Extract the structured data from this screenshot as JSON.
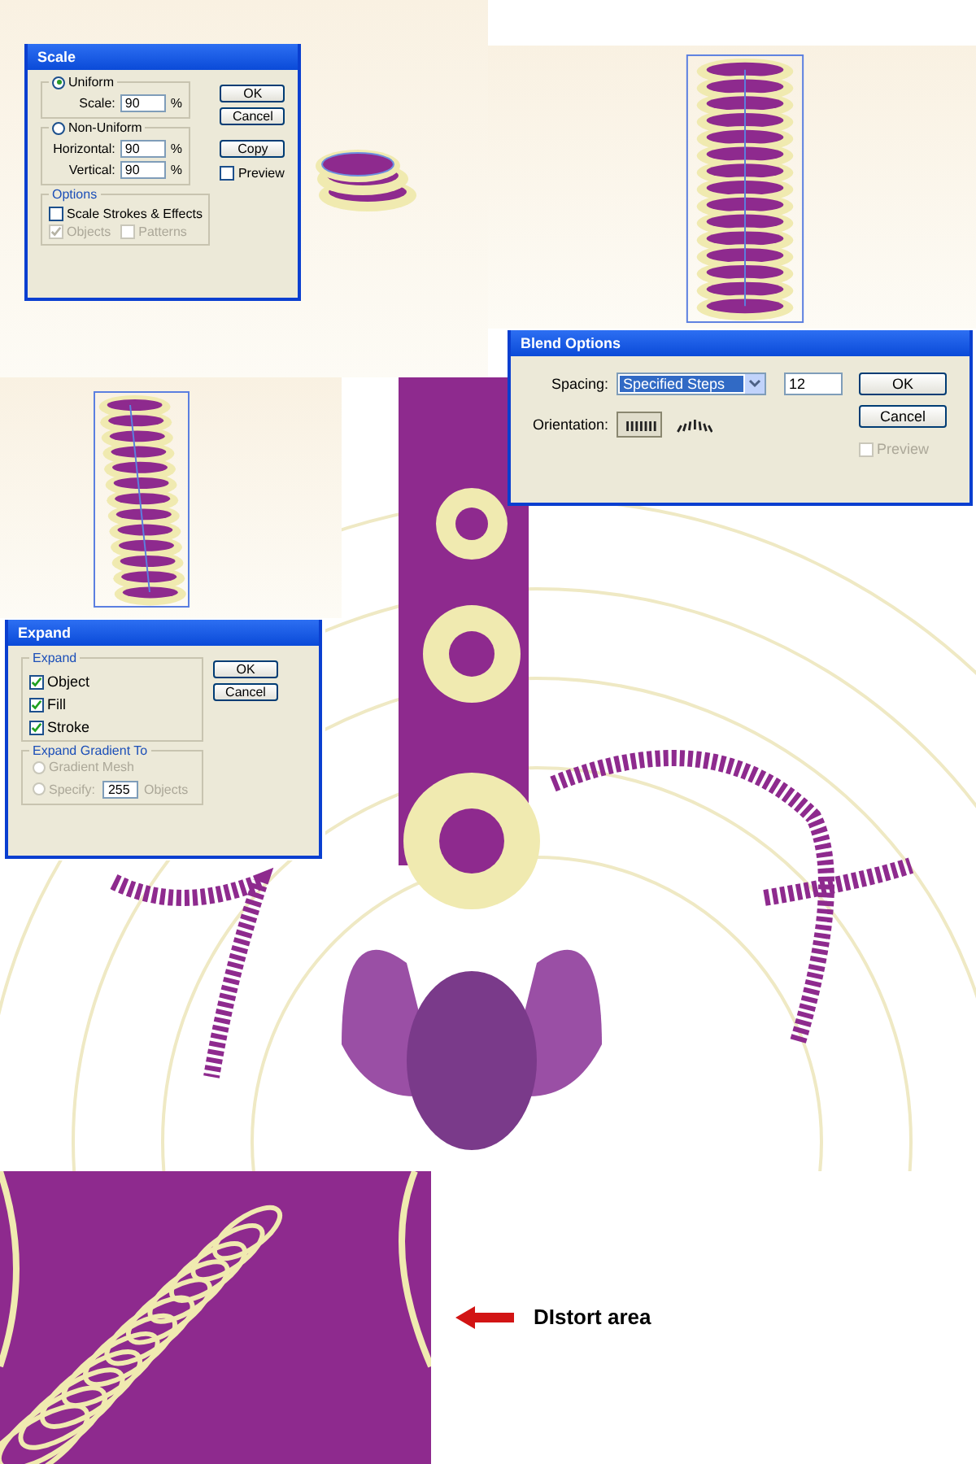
{
  "scale_dialog": {
    "title": "Scale",
    "uniform": {
      "label": "Uniform",
      "selected": true
    },
    "scale": {
      "label": "Scale:",
      "value": "90",
      "unit": "%"
    },
    "non_uniform": {
      "label": "Non-Uniform",
      "selected": false
    },
    "horizontal": {
      "label": "Horizontal:",
      "value": "90",
      "unit": "%"
    },
    "vertical": {
      "label": "Vertical:",
      "value": "90",
      "unit": "%"
    },
    "options": {
      "title": "Options",
      "items": [
        {
          "label": "Scale Strokes & Effects",
          "checked": false,
          "disabled": false
        },
        {
          "label": "Objects",
          "checked": true,
          "disabled": true
        },
        {
          "label": "Patterns",
          "checked": false,
          "disabled": true
        }
      ]
    },
    "buttons": [
      "OK",
      "Cancel",
      "Copy"
    ],
    "preview": {
      "label": "Preview",
      "checked": false,
      "disabled": false
    }
  },
  "blend_dialog": {
    "title": "Blend Options",
    "spacing": {
      "label": "Spacing:",
      "value": "Specified Steps",
      "steps": "12"
    },
    "orientation": {
      "label": "Orientation:",
      "options": [
        {
          "selected": true
        },
        {
          "selected": false
        }
      ]
    },
    "buttons": [
      "OK",
      "Cancel"
    ],
    "preview": {
      "label": "Preview",
      "checked": false,
      "disabled": true
    }
  },
  "expand_dialog": {
    "title": "Expand",
    "expand": {
      "title": "Expand",
      "items": [
        {
          "label": "Object",
          "checked": true
        },
        {
          "label": "Fill",
          "checked": true
        },
        {
          "label": "Stroke",
          "checked": true
        }
      ]
    },
    "gradient": {
      "title": "Expand Gradient To",
      "disabled": true,
      "mesh_label": "Gradient Mesh",
      "specify_label": "Specify:",
      "value": "255",
      "unit": "Objects"
    },
    "buttons": [
      "OK",
      "Cancel"
    ]
  },
  "callout": {
    "label": "DIstort area"
  }
}
